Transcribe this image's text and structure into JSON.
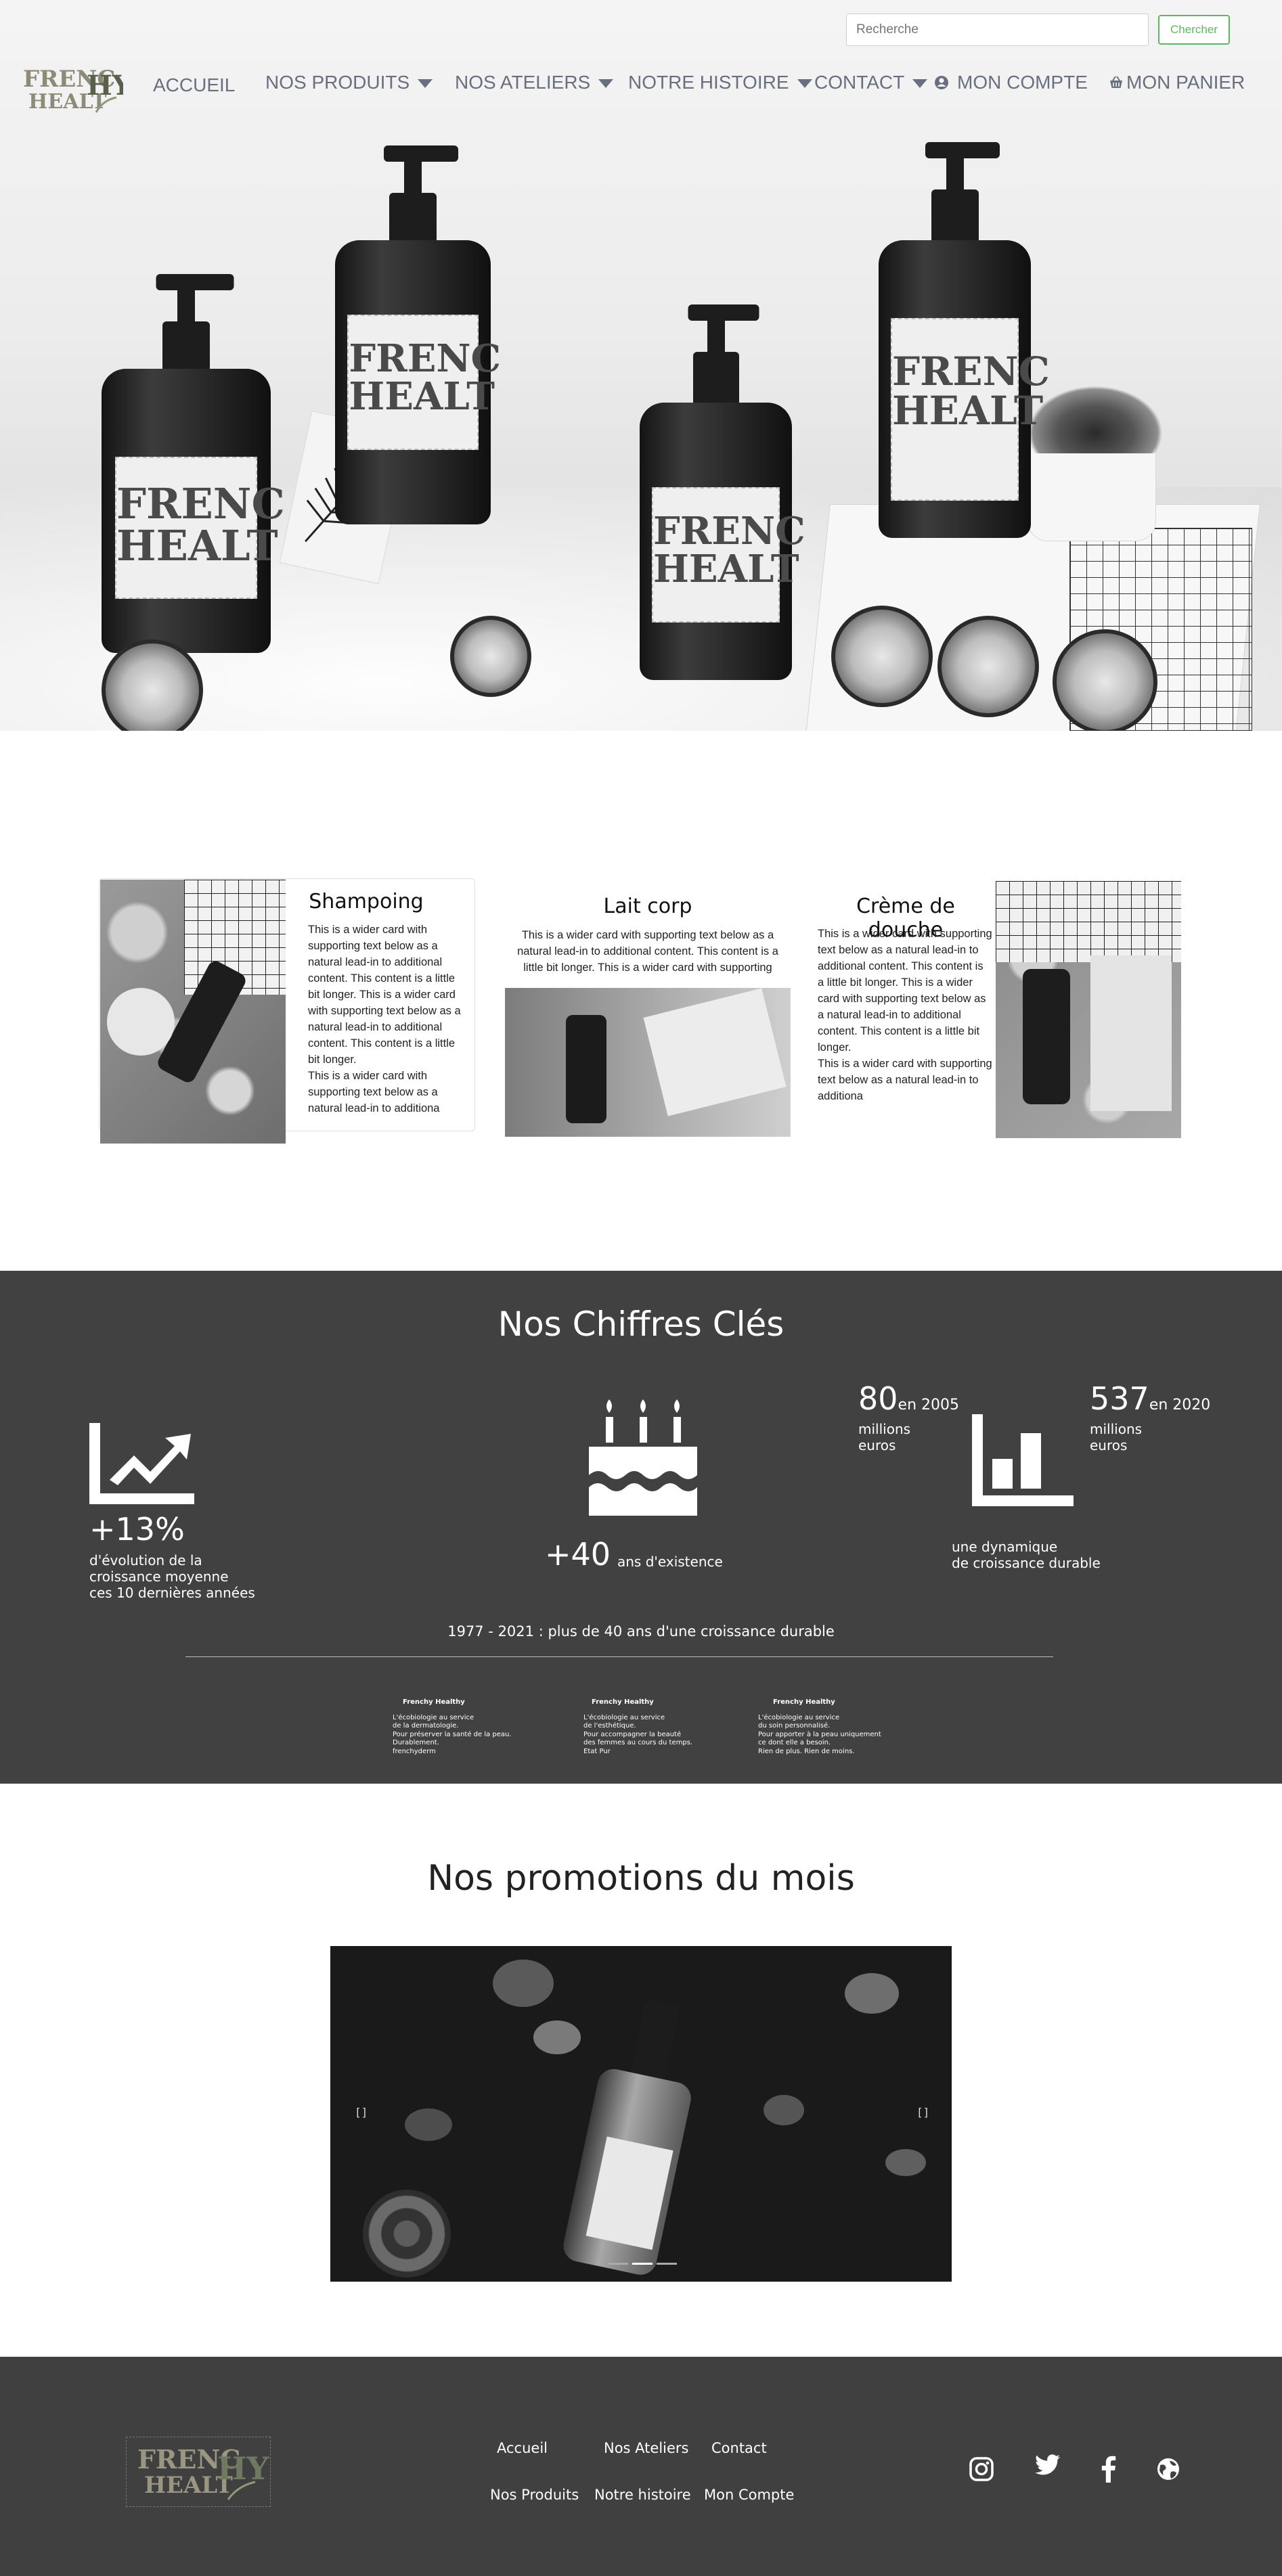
{
  "header": {
    "search_placeholder": "Recherche",
    "search_button": "Chercher",
    "brand_logo_text": "FRENCHY HEALTHY",
    "nav": [
      {
        "label": "ACCUEIL",
        "dropdown": false
      },
      {
        "label": "NOS PRODUITS",
        "dropdown": true
      },
      {
        "label": "NOS ATELIERS",
        "dropdown": true
      },
      {
        "label": "NOTRE HISTOIRE",
        "dropdown": true
      },
      {
        "label": "CONTACT",
        "dropdown": true
      },
      {
        "label": "MON COMPTE",
        "icon": "user-circle-icon"
      },
      {
        "label": "MON PANIER",
        "icon": "basket-icon"
      }
    ]
  },
  "cards": [
    {
      "title": "Shampoing",
      "text": "This is a wider card with supporting text below as a natural lead-in to additional content. This content is a little bit longer. This is a wider card with supporting text below as a natural lead-in to additional content. This content is a little bit longer.\nThis is a wider card with supporting text below as a natural lead-in to additiona"
    },
    {
      "title": "Lait corp",
      "text": "This is a wider card with supporting text below as a natural lead-in to additional content. This content is a little bit longer. This is a wider card with supporting"
    },
    {
      "title": "Crème de douche",
      "text": "This is a wider card with supporting text below as a natural lead-in to additional content. This content is a little bit longer. This is a wider card with supporting text below as a natural lead-in to additional content. This content is a little bit longer.\nThis is a wider card with supporting text below as a natural lead-in to additiona"
    }
  ],
  "stats": {
    "title": "Nos Chiffres Clés",
    "growth": {
      "value": "+13%",
      "caption_1": "d'évolution de la",
      "caption_2": "croissance moyenne",
      "caption_3": "ces 10 dernières années"
    },
    "age": {
      "value": "+40",
      "caption": "ans d'existence"
    },
    "rev2005": {
      "value": "80",
      "suffix": "en 2005",
      "unit_1": "millions",
      "unit_2": "euros"
    },
    "rev2020": {
      "value": "537",
      "suffix": "en 2020",
      "unit_1": "millions",
      "unit_2": "euros"
    },
    "dynamic": {
      "line_1": "une dynamique",
      "line_2": "de croissance durable"
    },
    "timeline": "1977 - 2021 : plus de 40 ans d'une croissance durable",
    "brands": [
      {
        "name": "Frenchy Healthy",
        "lines": [
          "L'écobiologie au service",
          "de la dermatologie.",
          "Pour préserver la santé de la peau.",
          "Durablement.",
          "frenchyderm"
        ]
      },
      {
        "name": "Frenchy Healthy",
        "lines": [
          "L'écobiologie au service",
          "de l'esthétique.",
          "Pour accompagner la beauté",
          "des femmes au cours du temps.",
          "Etat Pur"
        ]
      },
      {
        "name": "Frenchy Healthy",
        "lines": [
          "L'écobiologie au service",
          "du soin personnalisé.",
          "Pour apporter à la peau uniquement",
          "ce dont elle a besoin.",
          "Rien de plus. Rien de moins."
        ]
      }
    ]
  },
  "promo": {
    "title": "Nos promotions du mois",
    "prev_glyph": "[]",
    "next_glyph": "[]",
    "slides": 3,
    "active_slide": 2
  },
  "footer": {
    "logo_text": "FRENCHY HEALTHY",
    "links_row1": [
      "Accueil",
      "Nos Ateliers",
      "Contact"
    ],
    "links_row2": [
      "Nos Produits",
      "Notre histoire",
      "Mon Compte"
    ],
    "social": [
      "instagram-icon",
      "twitter-icon",
      "facebook-icon",
      "globe-icon"
    ]
  },
  "colors": {
    "dark_band": "#414141",
    "footer": "#404040",
    "button_green": "#5cb85c",
    "nav_text": "#6a6f80"
  }
}
